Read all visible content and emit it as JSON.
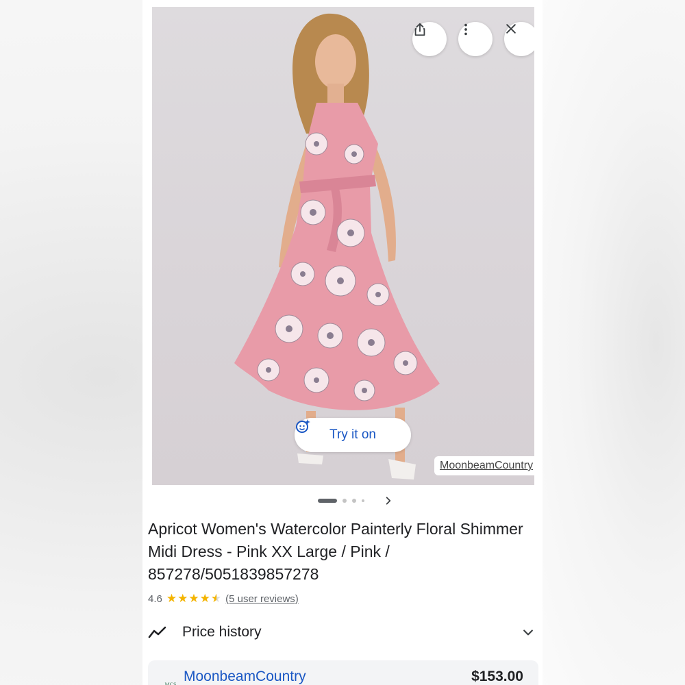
{
  "product": {
    "image_alt": "Woman wearing a pink floral halter-neck midi dress",
    "title": "Apricot Women's Watercolor Painterly Floral Shimmer Midi Dress - Pink XX Large / Pink / 857278/5051839857278",
    "rating": "4.6",
    "rating_value": 4.6,
    "reviews_label": "(5 user reviews)"
  },
  "image_overlay": {
    "try_on_label": "Try it on",
    "source_label": "MoonbeamCountry",
    "carousel_total": 4,
    "carousel_active": 1
  },
  "toolbar": {
    "share_icon": "share-icon",
    "more_icon": "more-vert-icon",
    "close_icon": "close-icon"
  },
  "price_history": {
    "label": "Price history"
  },
  "seller": {
    "name": "MoonbeamCountry",
    "logo_text": "MCS",
    "price": "$153.00"
  },
  "colors": {
    "link_blue": "#1a57c4",
    "star_gold": "#f4b400",
    "text_dark": "#202124"
  }
}
